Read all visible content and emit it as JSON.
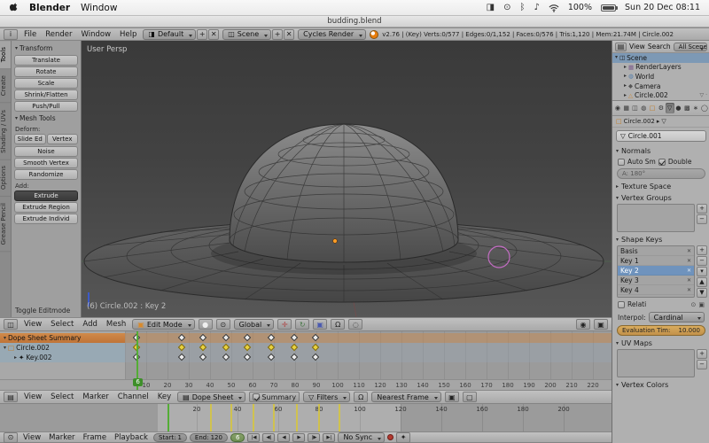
{
  "menubar": {
    "app_name": "Blender",
    "menu_window": "Window",
    "battery_label": "100%",
    "clock_text": "Sun 20 Dec 08:11"
  },
  "window_title": "budding.blend",
  "info": {
    "menus": [
      "File",
      "Render",
      "Window",
      "Help"
    ],
    "layout_value": "Default",
    "scene_value": "Scene",
    "engine_value": "Cycles Render",
    "add_label": "+",
    "close_label": "✕",
    "stats": "v2.76 | (Key) Verts:0/577 | Edges:0/1,152 | Faces:0/576 | Tris:1,120 | Mem:21.74M | Circle.002"
  },
  "tool_shelf": {
    "tabs": [
      "Tools",
      "Create",
      "Shading / UVs",
      "Options",
      "Grease Pencil"
    ],
    "transform_title": "Transform",
    "transform_buttons": [
      "Translate",
      "Rotate",
      "Scale",
      "Shrink/Flatten",
      "Push/Pull"
    ],
    "mesh_tools_title": "Mesh Tools",
    "deform_label": "Deform:",
    "deform_split": [
      "Slide Ed",
      "Vertex"
    ],
    "deform_buttons": [
      "Noise",
      "Smooth Vertex",
      "Randomize"
    ],
    "add_label": "Add:",
    "extrude_menu": "Extrude",
    "add_buttons": [
      "Extrude Region",
      "Extrude Individ"
    ],
    "operator_panel": "Toggle Editmode"
  },
  "viewport": {
    "view_label": "User Persp",
    "status_label": "(6) Circle.002 : Key 2",
    "menus": [
      "View",
      "Select",
      "Add",
      "Mesh"
    ],
    "mode_value": "Edit Mode",
    "orientation_value": "Global"
  },
  "outliner": {
    "menus": [
      "View",
      "Search"
    ],
    "display_value": "All Scenes",
    "items": [
      "Scene",
      "RenderLayers",
      "World",
      "Camera",
      "Circle.002"
    ]
  },
  "properties": {
    "breadcrumb_object": "Circle.002",
    "name_value": "Circle.001",
    "normals_title": "Normals",
    "auto_smooth_label": "Auto Sm",
    "double_label": "Double",
    "angle_label": "A: 180°",
    "texture_space_title": "Texture Space",
    "vertex_groups_title": "Vertex Groups",
    "shape_keys_title": "Shape Keys",
    "shape_keys": [
      "Basis",
      "Key 1",
      "Key 2",
      "Key 3",
      "Key 4"
    ],
    "relative_label": "Relati",
    "interpol_label": "Interpol:",
    "interpol_value": "Cardinal",
    "eval_label": "Evaluation Tim:",
    "eval_value": "10.000",
    "uv_maps_title": "UV Maps",
    "vertex_colors_title": "Vertex Colors"
  },
  "dope_sheet": {
    "channels": [
      "Dope Sheet Summary",
      "Circle.002",
      "Key.002"
    ],
    "keyframes": [
      6,
      27,
      37,
      48,
      58,
      69,
      80,
      90
    ],
    "ruler": {
      "start": 10,
      "end": 220,
      "step": 10
    },
    "current_frame": 6,
    "menus": [
      "View",
      "Select",
      "Marker",
      "Channel",
      "Key"
    ],
    "mode_value": "Dope Sheet",
    "summary_label": "Summary",
    "filters_label": "Filters",
    "snap_value": "Nearest Frame"
  },
  "timeline": {
    "ruler": {
      "start": 20,
      "end": 200,
      "step": 20
    },
    "keyframes": [
      6,
      27,
      37,
      48,
      58,
      69,
      80,
      90
    ],
    "current_frame": 6,
    "frame_start": 1,
    "frame_end": 120,
    "menus": [
      "View",
      "Marker",
      "Frame",
      "Playback"
    ],
    "start_label": "Start:",
    "start_value": "1",
    "end_label": "End:",
    "end_value": "120",
    "frame_value": "6",
    "sync_value": "No Sync",
    "play_buttons": [
      "|◀",
      "◀|",
      "◀",
      "▶",
      "|▶",
      "▶|"
    ]
  },
  "icons": {
    "display": "◨",
    "clock": "⊙",
    "bluetooth": "ᛒ",
    "volume": "♪",
    "editor-info": "i",
    "editor-3d": "◫",
    "editor-dope": "▤",
    "editor-timeline": "⊙",
    "tri-down": "▾",
    "tri-right": "▸",
    "mode-edit": "▣",
    "shading-sphere": "●",
    "pivot": "⊙",
    "manip-translate": "✛",
    "manip-rotate": "↻",
    "manip-scale": "▣",
    "magnet": "Ω",
    "funnel": "▽",
    "copy": "▣",
    "paste": "▢",
    "record": "●",
    "keying": "✦",
    "scene": "◫",
    "renderlayers": "▦",
    "world": "◍",
    "camera": "◆",
    "mesh-circle": "△",
    "mesh-data": "▽",
    "object": "□",
    "ghost": "◌",
    "x": "✕",
    "dot": "·",
    "breadcrumb-sep": "▸",
    "tab-render": "◉",
    "tab-layers": "▦",
    "tab-scene": "◫",
    "tab-world": "◍",
    "tab-object": "□",
    "tab-modifiers": "⚙",
    "tab-data": "▽",
    "tab-material": "●",
    "tab-texture": "▩",
    "tab-particles": "∗",
    "tab-physics": "◯"
  },
  "colors": {
    "accent_orange": "#cc7a3c",
    "selected_blue": "#7d99b5",
    "current_frame_green": "#54ad35",
    "keyframe_yellow": "#e8d23e",
    "animated_field": "#cf9e54"
  }
}
